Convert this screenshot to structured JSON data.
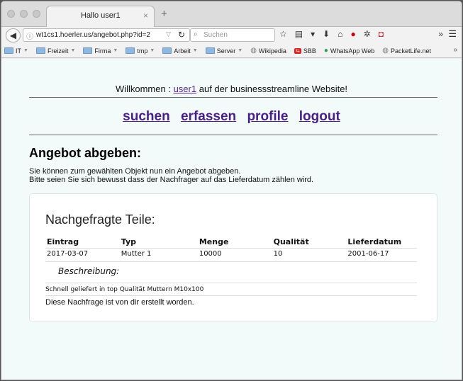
{
  "browser": {
    "tab": {
      "title": "Hallo user1",
      "close": "×"
    },
    "new_tab": "+",
    "address": {
      "info_icon": "ⓘ",
      "url": "wt1cs1.hoerler.us/angebot.php?id=2"
    },
    "search": {
      "placeholder": "Suchen"
    },
    "bookmarks": [
      {
        "label": "IT",
        "type": "folder"
      },
      {
        "label": "Freizeit",
        "type": "folder"
      },
      {
        "label": "Firma",
        "type": "folder"
      },
      {
        "label": "tmp",
        "type": "folder"
      },
      {
        "label": "Arbeit",
        "type": "folder"
      },
      {
        "label": "Server",
        "type": "folder"
      },
      {
        "label": "Wikipedia",
        "type": "link"
      },
      {
        "label": "SBB",
        "type": "link"
      },
      {
        "label": "WhatsApp Web",
        "type": "link"
      },
      {
        "label": "PacketLife.net",
        "type": "link"
      }
    ]
  },
  "page": {
    "welcome_prefix": "Willkommen :",
    "welcome_user": "user1",
    "welcome_suffix": "auf der businessstreamline Website!",
    "nav": [
      "suchen",
      "erfassen",
      "profile",
      "logout"
    ],
    "heading": "Angebot abgeben:",
    "intro_line1": "Sie können zum gewählten Objekt nun ein Angebot abgeben.",
    "intro_line2": "Bitte seien Sie sich bewusst dass der Nachfrager auf das Lieferdatum zählen wird.",
    "card": {
      "title": "Nachgefragte Teile:",
      "columns": [
        "Eintrag",
        "Typ",
        "Menge",
        "Qualität",
        "Lieferdatum"
      ],
      "row": [
        "2017-03-07",
        "Mutter 1",
        "10000",
        "10",
        "2001-06-17"
      ],
      "description_label": "Beschreibung:",
      "description": "Schnell geliefert in top Qualität Muttern M10x100",
      "note": "Diese Nachfrage ist von dir erstellt worden."
    }
  }
}
